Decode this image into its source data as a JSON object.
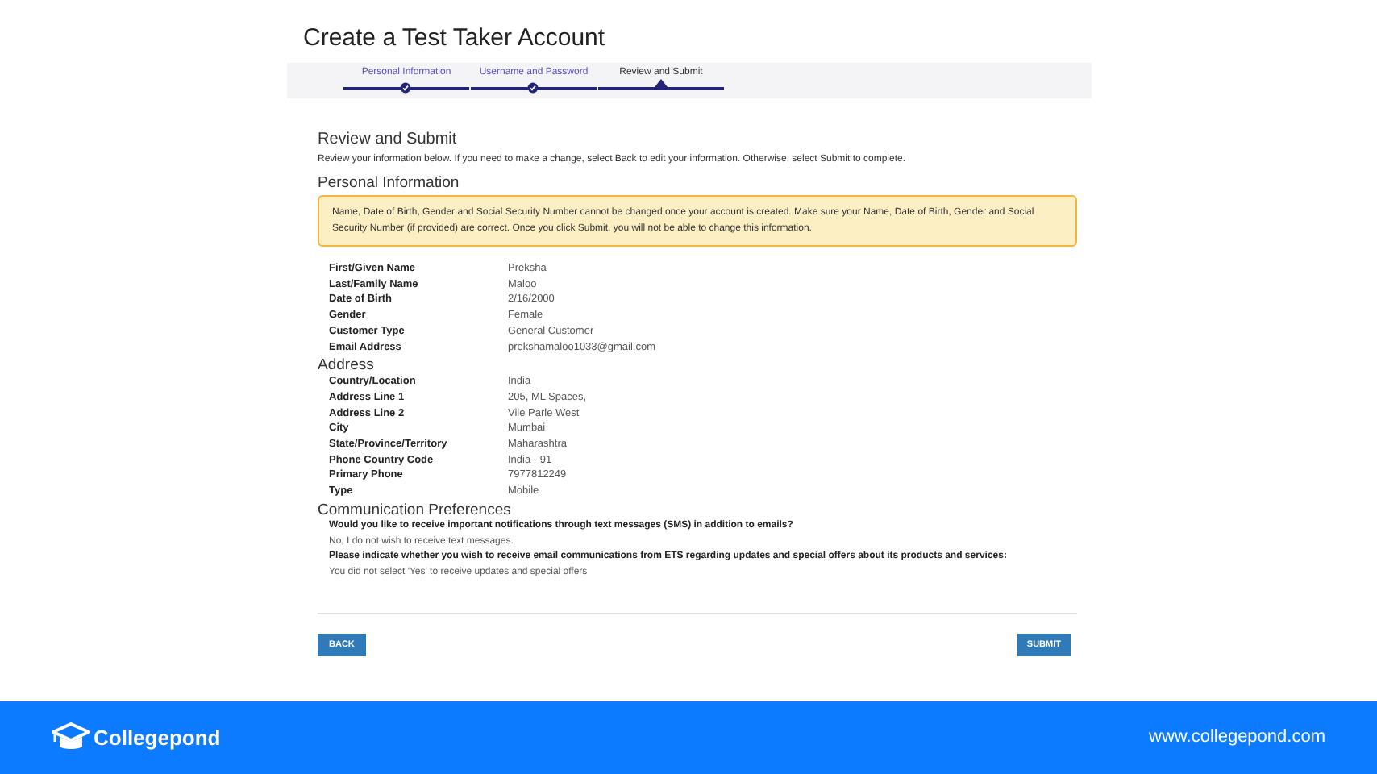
{
  "page_title": "Create a Test Taker Account",
  "steps": [
    {
      "label": "Personal Information",
      "completed": true,
      "selected": false
    },
    {
      "label": "Username and Password",
      "completed": true,
      "selected": false
    },
    {
      "label": "Review and Submit",
      "completed": false,
      "selected": true
    }
  ],
  "heading": "Review and Submit",
  "intro": "Review your information below. If you need to make a change, select Back to edit your information. Otherwise, select Submit to complete.",
  "sections": [
    {
      "title": "Personal Information",
      "alert": "Name, Date of Birth, Gender and Social Security Number cannot be changed once your account is created. Make sure your Name, Date of Birth, Gender and Social Security Number (if provided) are correct. Once you click Submit, you will not be able to change this information.",
      "rows": [
        {
          "label": "First/Given Name",
          "value": "Preksha"
        },
        {
          "label": "Last/Family Name",
          "value": "Maloo"
        },
        {
          "label": "Date of Birth",
          "value": "2/16/2000"
        },
        {
          "label": "Gender",
          "value": "Female"
        },
        {
          "label": "Customer Type",
          "value": "General Customer"
        },
        {
          "label": "Email Address",
          "value": "prekshamaloo1033@gmail.com"
        }
      ]
    },
    {
      "title": "Address",
      "rows": [
        {
          "label": "Country/Location",
          "value": "India"
        },
        {
          "label": "Address Line 1",
          "value": "205, ML Spaces,"
        },
        {
          "label": "Address Line 2",
          "value": "Vile Parle West"
        },
        {
          "label": "City",
          "value": "Mumbai"
        },
        {
          "label": "State/Province/Territory",
          "value": "Maharashtra"
        },
        {
          "label": "Phone Country Code",
          "value": "India - 91"
        },
        {
          "label": "Primary Phone",
          "value": "7977812249"
        },
        {
          "label": "Type",
          "value": "Mobile"
        }
      ]
    }
  ],
  "communication": {
    "title": "Communication Preferences",
    "items": [
      {
        "question": "Would you like to receive important notifications through text messages (SMS) in addition to emails?",
        "answer": "No, I do not wish to receive text messages."
      },
      {
        "question": "Please indicate whether you wish to receive email communications from ETS regarding updates and special offers about its products and services:",
        "answer": "You did not select 'Yes' to receive updates and special offers"
      }
    ]
  },
  "buttons": {
    "back": "BACK",
    "submit": "SUBMIT"
  },
  "footer": {
    "brand": "Collegepond",
    "url": "www.collegepond.com"
  }
}
